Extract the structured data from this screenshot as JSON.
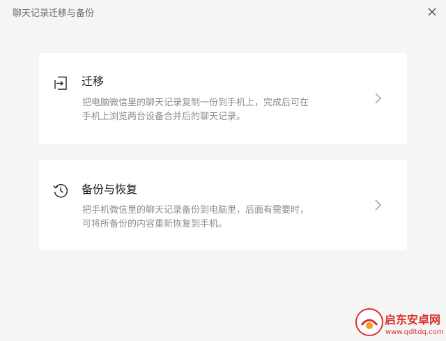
{
  "window": {
    "title": "聊天记录迁移与备份"
  },
  "icons": {
    "close": "close-icon",
    "migrate": "migrate-icon",
    "backup": "history-clock-icon",
    "chevron": "chevron-right-icon"
  },
  "cards": [
    {
      "title": "迁移",
      "desc_line1": "把电脑微信里的聊天记录复制一份到手机上，完成后可在",
      "desc_line2": "手机上浏览两台设备合并后的聊天记录。"
    },
    {
      "title": "备份与恢复",
      "desc_line1": "把手机微信里的聊天记录备份到电脑里，后面有需要时，",
      "desc_line2": "可将所备份的内容重新恢复到手机。"
    }
  ],
  "watermark": {
    "name": "启东安卓网",
    "url": "www.qdltdq.com"
  },
  "colors": {
    "background": "#f5f5f5",
    "card": "#ffffff",
    "title": "#1a1a1a",
    "description": "#8c8c8c",
    "watermark_red": "#d9302b"
  }
}
